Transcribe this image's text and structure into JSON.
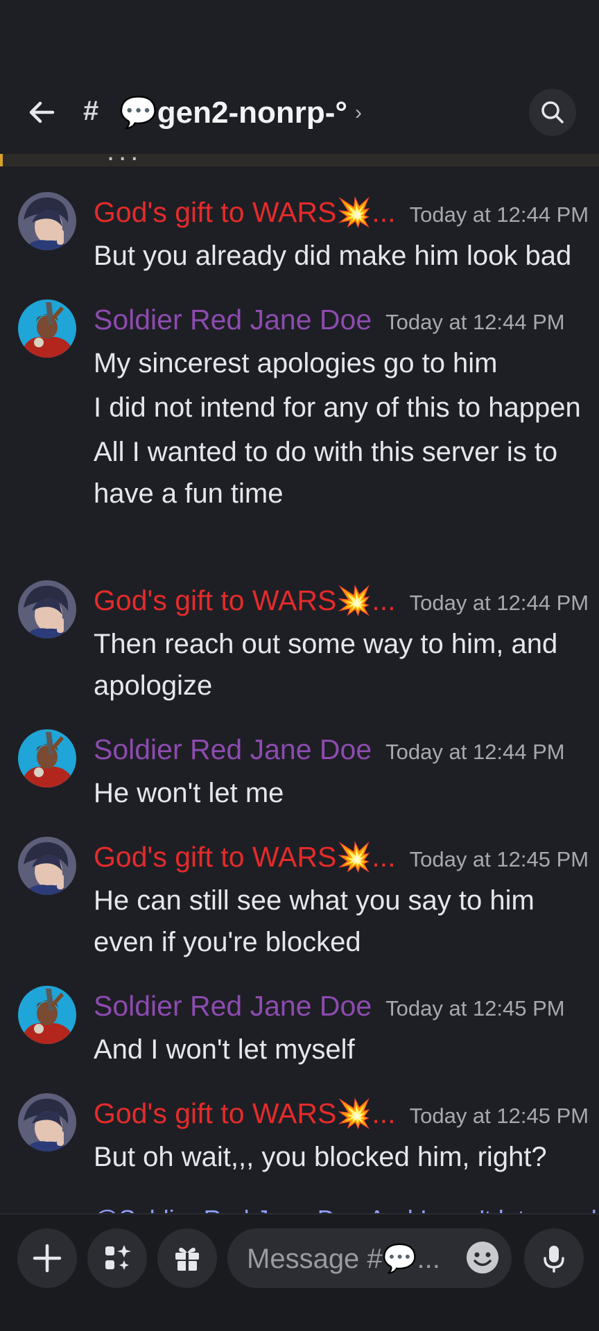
{
  "header": {
    "hash": "#",
    "channel_name": "💬gen2-nonrp-°",
    "chevron": "›"
  },
  "messages": [
    {
      "author": "God's gift to WARS💥...",
      "author_color": "#e52b2b",
      "avatar": "god-gift-avatar",
      "timestamp": "Today at 12:44 PM",
      "lines": [
        "But you already did make him look bad"
      ]
    },
    {
      "author": "Soldier Red Jane Doe",
      "author_color": "#8d4bb0",
      "avatar": "soldier-avatar",
      "timestamp": "Today at 12:44 PM",
      "lines": [
        "My sincerest apologies go to him",
        "I did not intend for any of this to happen",
        "All I wanted to do with this server is to have a fun time"
      ]
    },
    {
      "author": "God's gift to WARS💥...",
      "author_color": "#e52b2b",
      "avatar": "god-gift-avatar",
      "timestamp": "Today at 12:44 PM",
      "lines": [
        "Then reach out some way to him, and apologize"
      ]
    },
    {
      "author": "Soldier Red Jane Doe",
      "author_color": "#8d4bb0",
      "avatar": "soldier-avatar",
      "timestamp": "Today at 12:44 PM",
      "lines": [
        "He won't let me"
      ]
    },
    {
      "author": "God's gift to WARS💥...",
      "author_color": "#e52b2b",
      "avatar": "god-gift-avatar",
      "timestamp": "Today at 12:45 PM",
      "lines": [
        "He can still see what you say to him even if you're blocked"
      ]
    },
    {
      "author": "Soldier Red Jane Doe",
      "author_color": "#8d4bb0",
      "avatar": "soldier-avatar",
      "timestamp": "Today at 12:45 PM",
      "lines": [
        "And I won't let myself"
      ]
    },
    {
      "author": "God's gift to WARS💥...",
      "author_color": "#e52b2b",
      "avatar": "god-gift-avatar",
      "timestamp": "Today at 12:45 PM",
      "lines": [
        "But oh wait,,, you blocked him, right?"
      ]
    }
  ],
  "reply_preview": "@Soldier Red Jane Doe And I won't let myself",
  "composer": {
    "placeholder": "Message #💬...",
    "icons": [
      "plus-icon",
      "apps-icon",
      "gift-icon",
      "emoji-icon",
      "mic-icon"
    ]
  },
  "colors": {
    "background": "#1e1f24",
    "name_red": "#e52b2b",
    "name_purple": "#8d4bb0",
    "highlight_bar": "#d8a12a"
  }
}
